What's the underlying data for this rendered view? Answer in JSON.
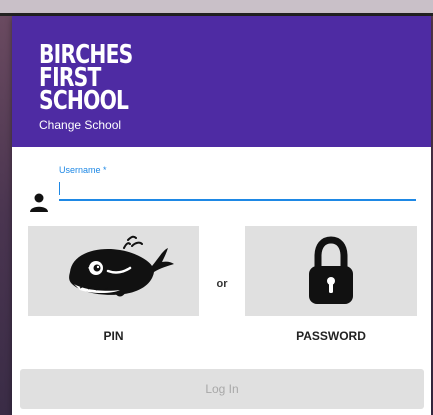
{
  "header": {
    "school_name": "BIRCHES FIRST SCHOOL",
    "change_school_label": "Change School",
    "background_color": "#4e2ba3"
  },
  "username": {
    "label": "Username *",
    "value": "",
    "accent_color": "#1e88e5",
    "icon": "person-icon"
  },
  "login_options": {
    "pin": {
      "label": "PIN",
      "icon": "whale-icon"
    },
    "separator": "or",
    "password": {
      "label": "PASSWORD",
      "icon": "padlock-icon"
    }
  },
  "login_button": {
    "label": "Log In",
    "enabled": false
  }
}
